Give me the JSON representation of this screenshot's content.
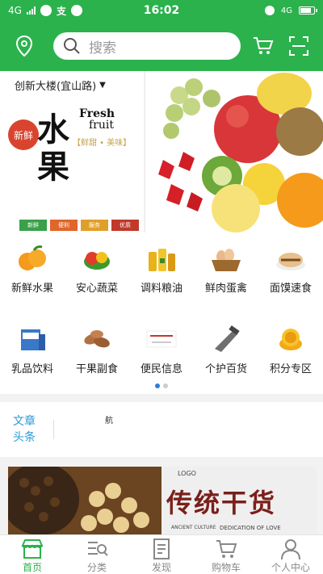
{
  "status_bar": {
    "network_left": "4G",
    "time": "16:02",
    "network_right": "4G"
  },
  "header": {
    "search_placeholder": "搜索"
  },
  "banner": {
    "location": "创新大楼(宜山路)",
    "headline_char_1": "水",
    "headline_char_2": "果",
    "badge": "新鲜",
    "english_1": "Fresh",
    "english_2": "fruit",
    "tagline": "【鲜甜 • 美味】",
    "tags": [
      "新鲜",
      "便利",
      "服务",
      "优质"
    ]
  },
  "categories": [
    {
      "label": "新鲜水果",
      "icon": "oranges-icon"
    },
    {
      "label": "安心蔬菜",
      "icon": "vegetables-icon"
    },
    {
      "label": "调料粮油",
      "icon": "oil-bottles-icon"
    },
    {
      "label": "鲜肉蛋禽",
      "icon": "eggs-basket-icon"
    },
    {
      "label": "面馍速食",
      "icon": "bread-icon"
    },
    {
      "label": "乳品饮料",
      "icon": "milk-box-icon"
    },
    {
      "label": "干果副食",
      "icon": "almonds-icon"
    },
    {
      "label": "便民信息",
      "icon": "info-card-icon"
    },
    {
      "label": "个护百货",
      "icon": "razor-icon"
    },
    {
      "label": "积分专区",
      "icon": "points-coins-icon"
    }
  ],
  "news": {
    "title": "文章头条",
    "item": "航"
  },
  "banner2": {
    "title": "传统干货",
    "logo": "LOGO",
    "caption_left": "ANCIENT CULTURE",
    "caption_right": "DEDICATION OF LOVE"
  },
  "tabs": [
    {
      "label": "首页",
      "active": true
    },
    {
      "label": "分类",
      "active": false
    },
    {
      "label": "发现",
      "active": false
    },
    {
      "label": "购物车",
      "active": false
    },
    {
      "label": "个人中心",
      "active": false
    }
  ],
  "colors": {
    "brand_green": "#2bb24c",
    "link_blue": "#2a9ad6"
  }
}
